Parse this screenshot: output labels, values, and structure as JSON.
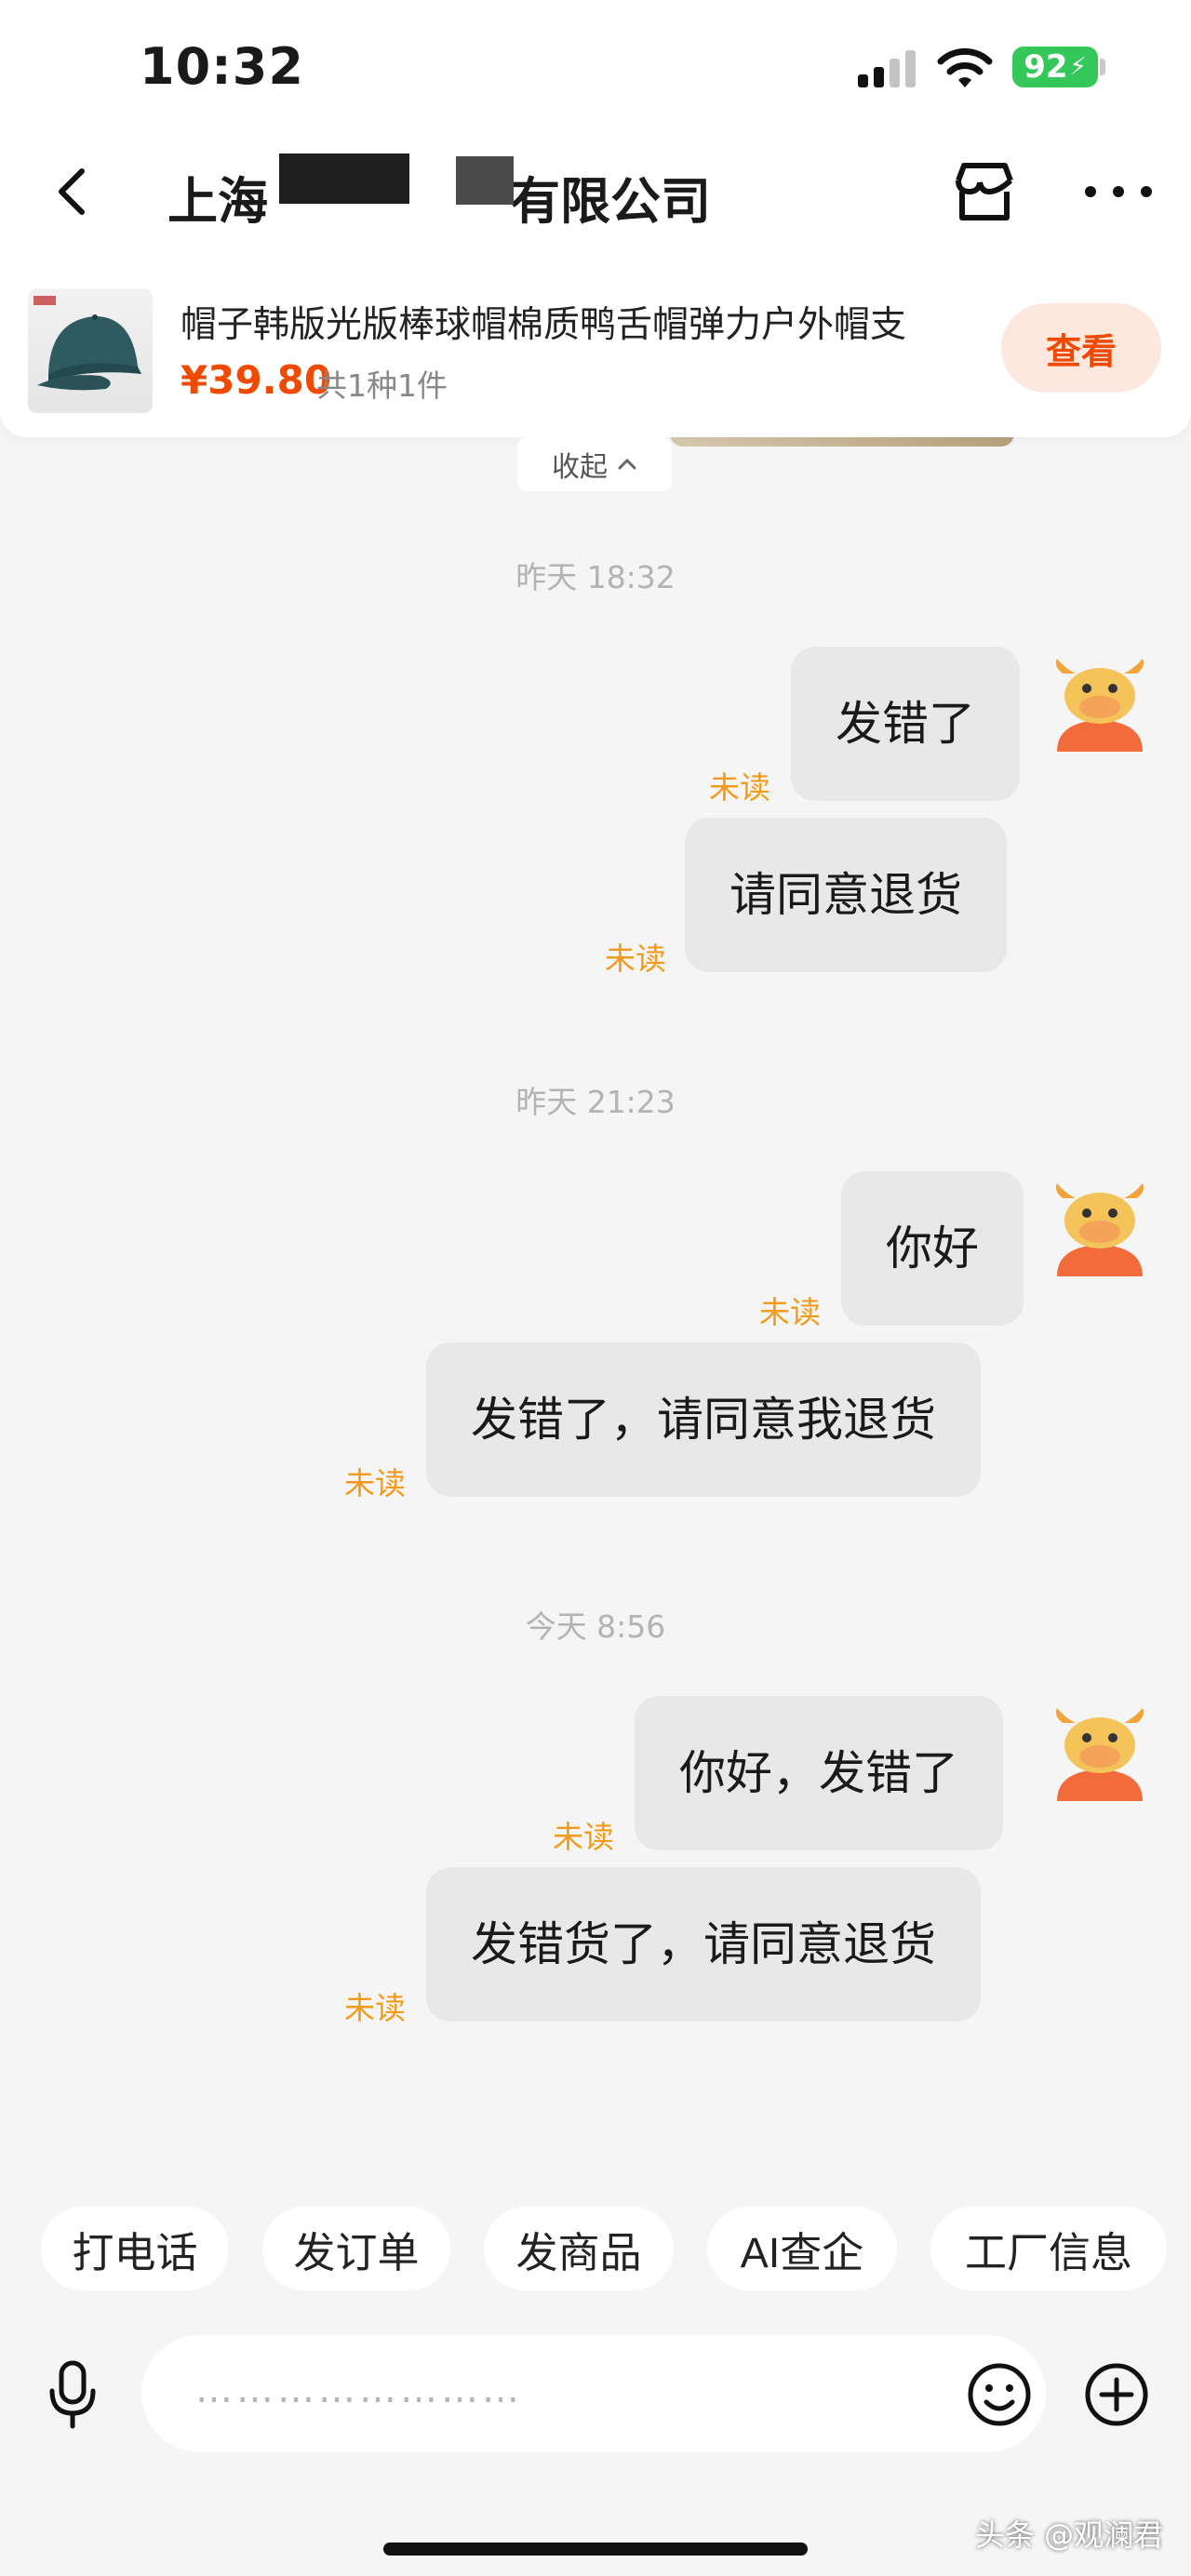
{
  "status_bar": {
    "time": "10:32",
    "battery": "92"
  },
  "nav": {
    "title_part1": "上海",
    "title_part2": "有限公司"
  },
  "product": {
    "name": "帽子韩版光版棒球帽棉质鸭舌帽弹力户外帽支",
    "price": "¥39.80",
    "quantity": "共1种1件",
    "view_label": "查看"
  },
  "collapse_label": "收起",
  "timestamps": [
    "昨天 18:32",
    "昨天 21:23",
    "今天 8:56"
  ],
  "unread_label": "未读",
  "messages": [
    {
      "text": "发错了"
    },
    {
      "text": "请同意退货"
    },
    {
      "text": "你好"
    },
    {
      "text": "发错了，请同意我退货"
    },
    {
      "text": "你好，发错了"
    },
    {
      "text": "发错货了，请同意退货"
    }
  ],
  "quick_actions": [
    "打电话",
    "发订单",
    "发商品",
    "AI查企",
    "工厂信息"
  ],
  "input": {
    "placeholder": "……………………"
  },
  "watermark": "头条 @观澜君",
  "colors": {
    "accent": "#f04a00",
    "unread": "#f39a1a",
    "bubble": "#e8e8e8",
    "battery": "#34c759"
  }
}
